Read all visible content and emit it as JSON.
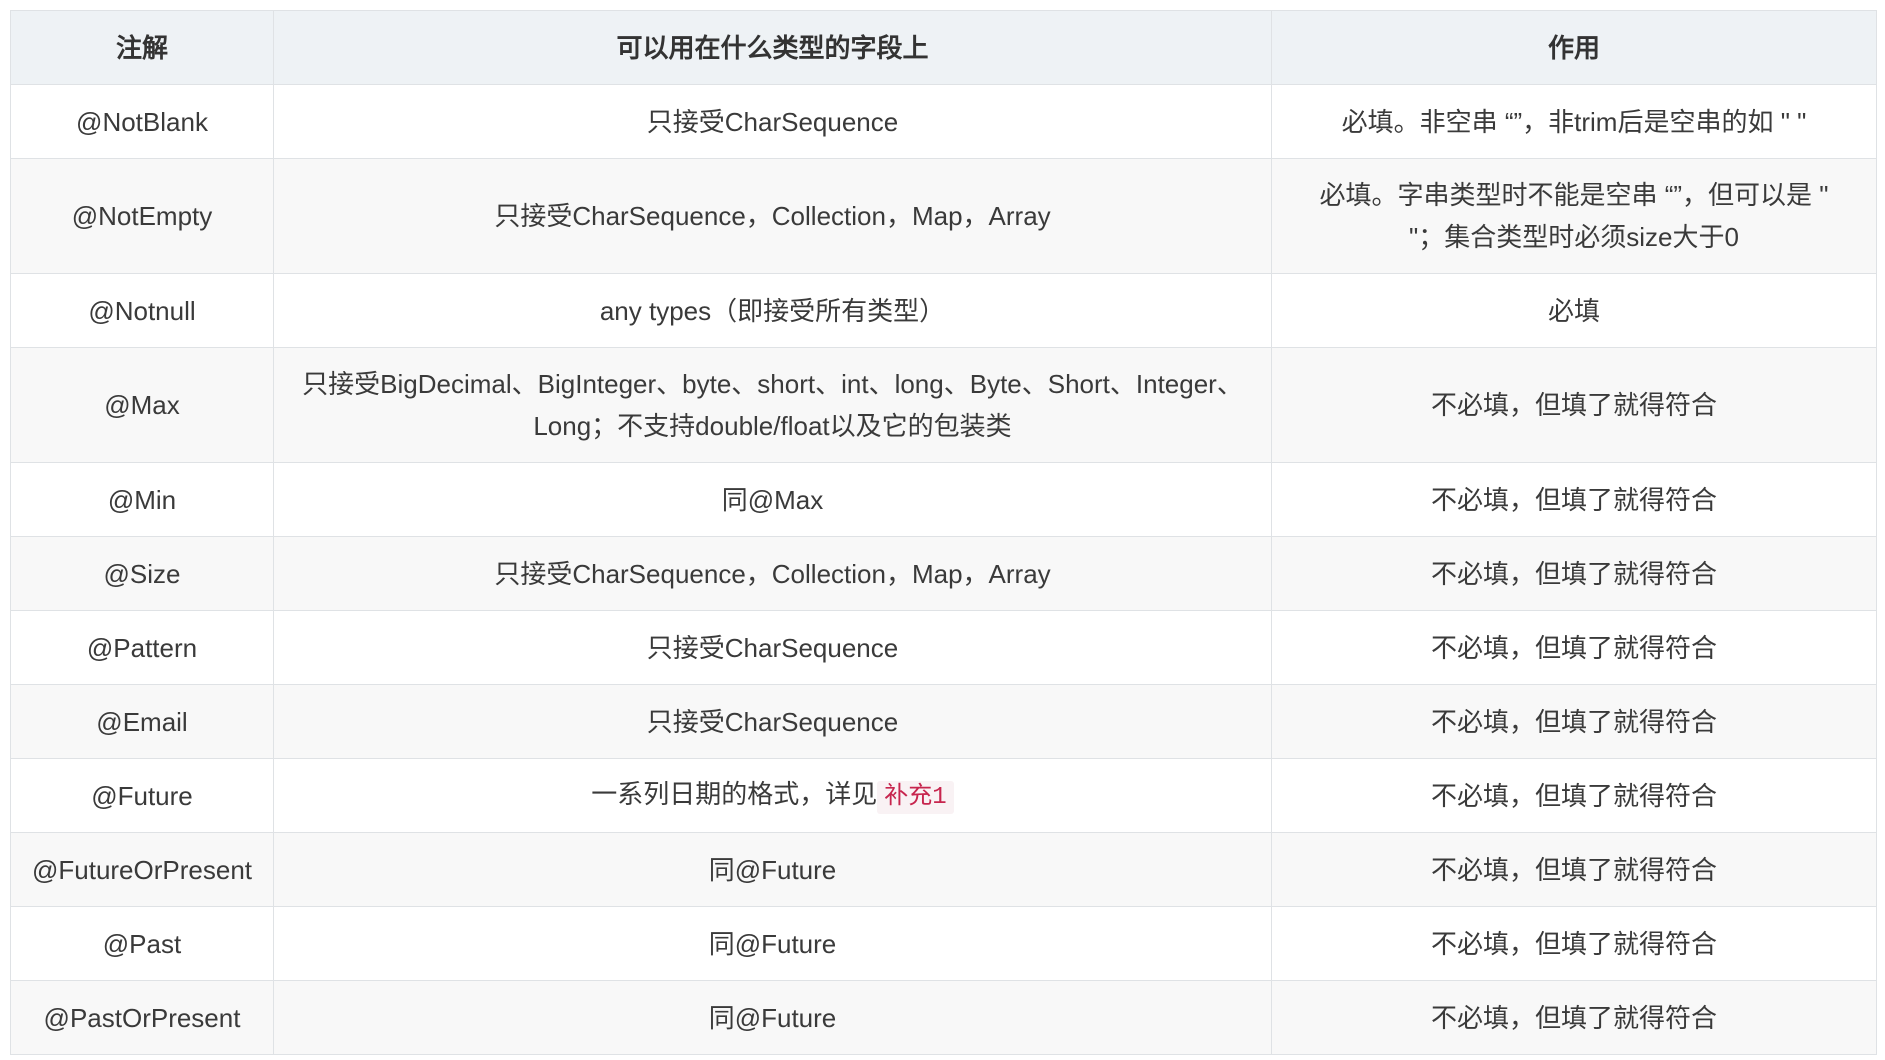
{
  "table": {
    "headers": {
      "annotation": "注解",
      "types": "可以用在什么类型的字段上",
      "effect": "作用"
    },
    "rows": [
      {
        "annotation": "@NotBlank",
        "types": "只接受CharSequence",
        "effect": "必填。非空串 “”，非trim后是空串的如 \" \""
      },
      {
        "annotation": "@NotEmpty",
        "types": "只接受CharSequence，Collection，Map，Array",
        "effect": "必填。字串类型时不能是空串 “”，但可以是 \" \"；集合类型时必须size大于0"
      },
      {
        "annotation": "@Notnull",
        "types": "any types（即接受所有类型）",
        "effect": "必填"
      },
      {
        "annotation": "@Max",
        "types": "只接受BigDecimal、BigInteger、byte、short、int、long、Byte、Short、Integer、Long；不支持double/float以及它的包装类",
        "effect": "不必填，但填了就得符合"
      },
      {
        "annotation": "@Min",
        "types": "同@Max",
        "effect": "不必填，但填了就得符合"
      },
      {
        "annotation": "@Size",
        "types": "只接受CharSequence，Collection，Map，Array",
        "effect": "不必填，但填了就得符合"
      },
      {
        "annotation": "@Pattern",
        "types": "只接受CharSequence",
        "effect": "不必填，但填了就得符合"
      },
      {
        "annotation": "@Email",
        "types": "只接受CharSequence",
        "effect": "不必填，但填了就得符合"
      },
      {
        "annotation": "@Future",
        "types": "一系列日期的格式，详见",
        "types_code": "补充1",
        "effect": "不必填，但填了就得符合"
      },
      {
        "annotation": "@FutureOrPresent",
        "types": "同@Future",
        "effect": "不必填，但填了就得符合"
      },
      {
        "annotation": "@Past",
        "types": "同@Future",
        "effect": "不必填，但填了就得符合"
      },
      {
        "annotation": "@PastOrPresent",
        "types": "同@Future",
        "effect": "不必填，但填了就得符合"
      }
    ]
  },
  "colors": {
    "header_background": "#eef2f5",
    "row_alt_background": "#f8f8f8",
    "border": "#dfe2e5",
    "text": "#3a3a3a",
    "header_text": "#333333",
    "code_text": "#c7254e",
    "code_background": "#f9f2f4"
  }
}
